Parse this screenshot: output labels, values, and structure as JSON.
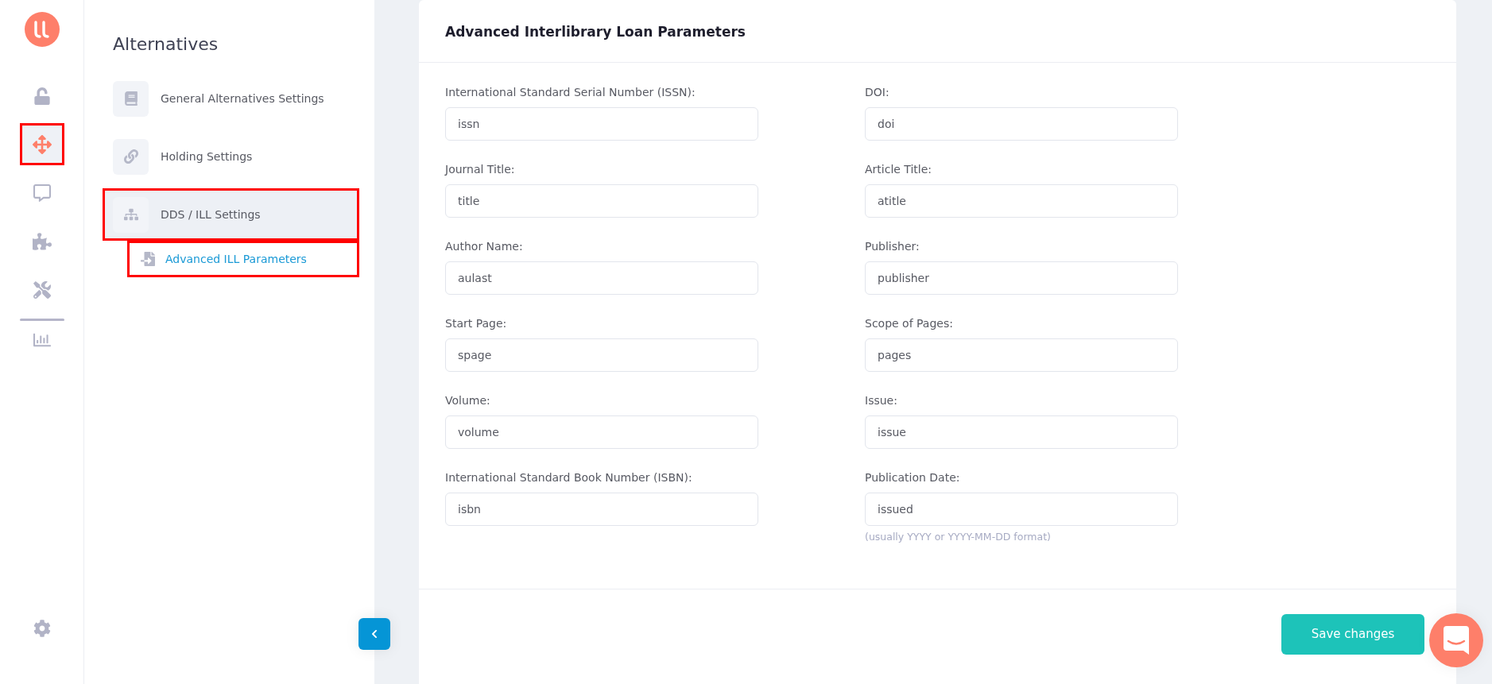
{
  "rail": {
    "groups": [
      {
        "items": [
          {
            "selected": false,
            "annotated": false
          },
          {
            "selected": true,
            "annotated": true
          },
          {
            "selected": false,
            "annotated": false
          },
          {
            "selected": false,
            "annotated": false
          },
          {
            "selected": false,
            "annotated": false
          }
        ]
      },
      {
        "items": [
          {
            "selected": false,
            "annotated": false
          }
        ]
      }
    ],
    "bottom_items": [
      {
        "selected": false,
        "annotated": false
      }
    ]
  },
  "sidebar": {
    "title": "Alternatives",
    "items": [
      {
        "label": "General Alternatives Settings",
        "selected": false,
        "annotated": false
      },
      {
        "label": "Holding Settings",
        "selected": false,
        "annotated": false
      },
      {
        "label": "DDS / ILL Settings",
        "selected": true,
        "annotated": true,
        "children": [
          {
            "label": "Advanced ILL Parameters",
            "selected": true,
            "annotated": true
          }
        ]
      }
    ]
  },
  "form": {
    "title": "Advanced Interlibrary Loan Parameters",
    "fields": [
      {
        "label": "International Standard Serial Number (ISSN):",
        "value": "issn"
      },
      {
        "label": "DOI:",
        "value": "doi"
      },
      {
        "label": "Journal Title:",
        "value": "title"
      },
      {
        "label": "Article Title:",
        "value": "atitle"
      },
      {
        "label": "Author Name:",
        "value": "aulast"
      },
      {
        "label": "Publisher:",
        "value": "publisher"
      },
      {
        "label": "Start Page:",
        "value": "spage"
      },
      {
        "label": "Scope of Pages:",
        "value": "pages"
      },
      {
        "label": "Volume:",
        "value": "volume"
      },
      {
        "label": "Issue:",
        "value": "issue"
      },
      {
        "label": "International Standard Book Number (ISBN):",
        "value": "isbn"
      },
      {
        "label": "Publication Date:",
        "value": "issued",
        "hint": "(usually YYYY or YYYY-MM-DD format)"
      }
    ],
    "save_button": "Save changes"
  }
}
